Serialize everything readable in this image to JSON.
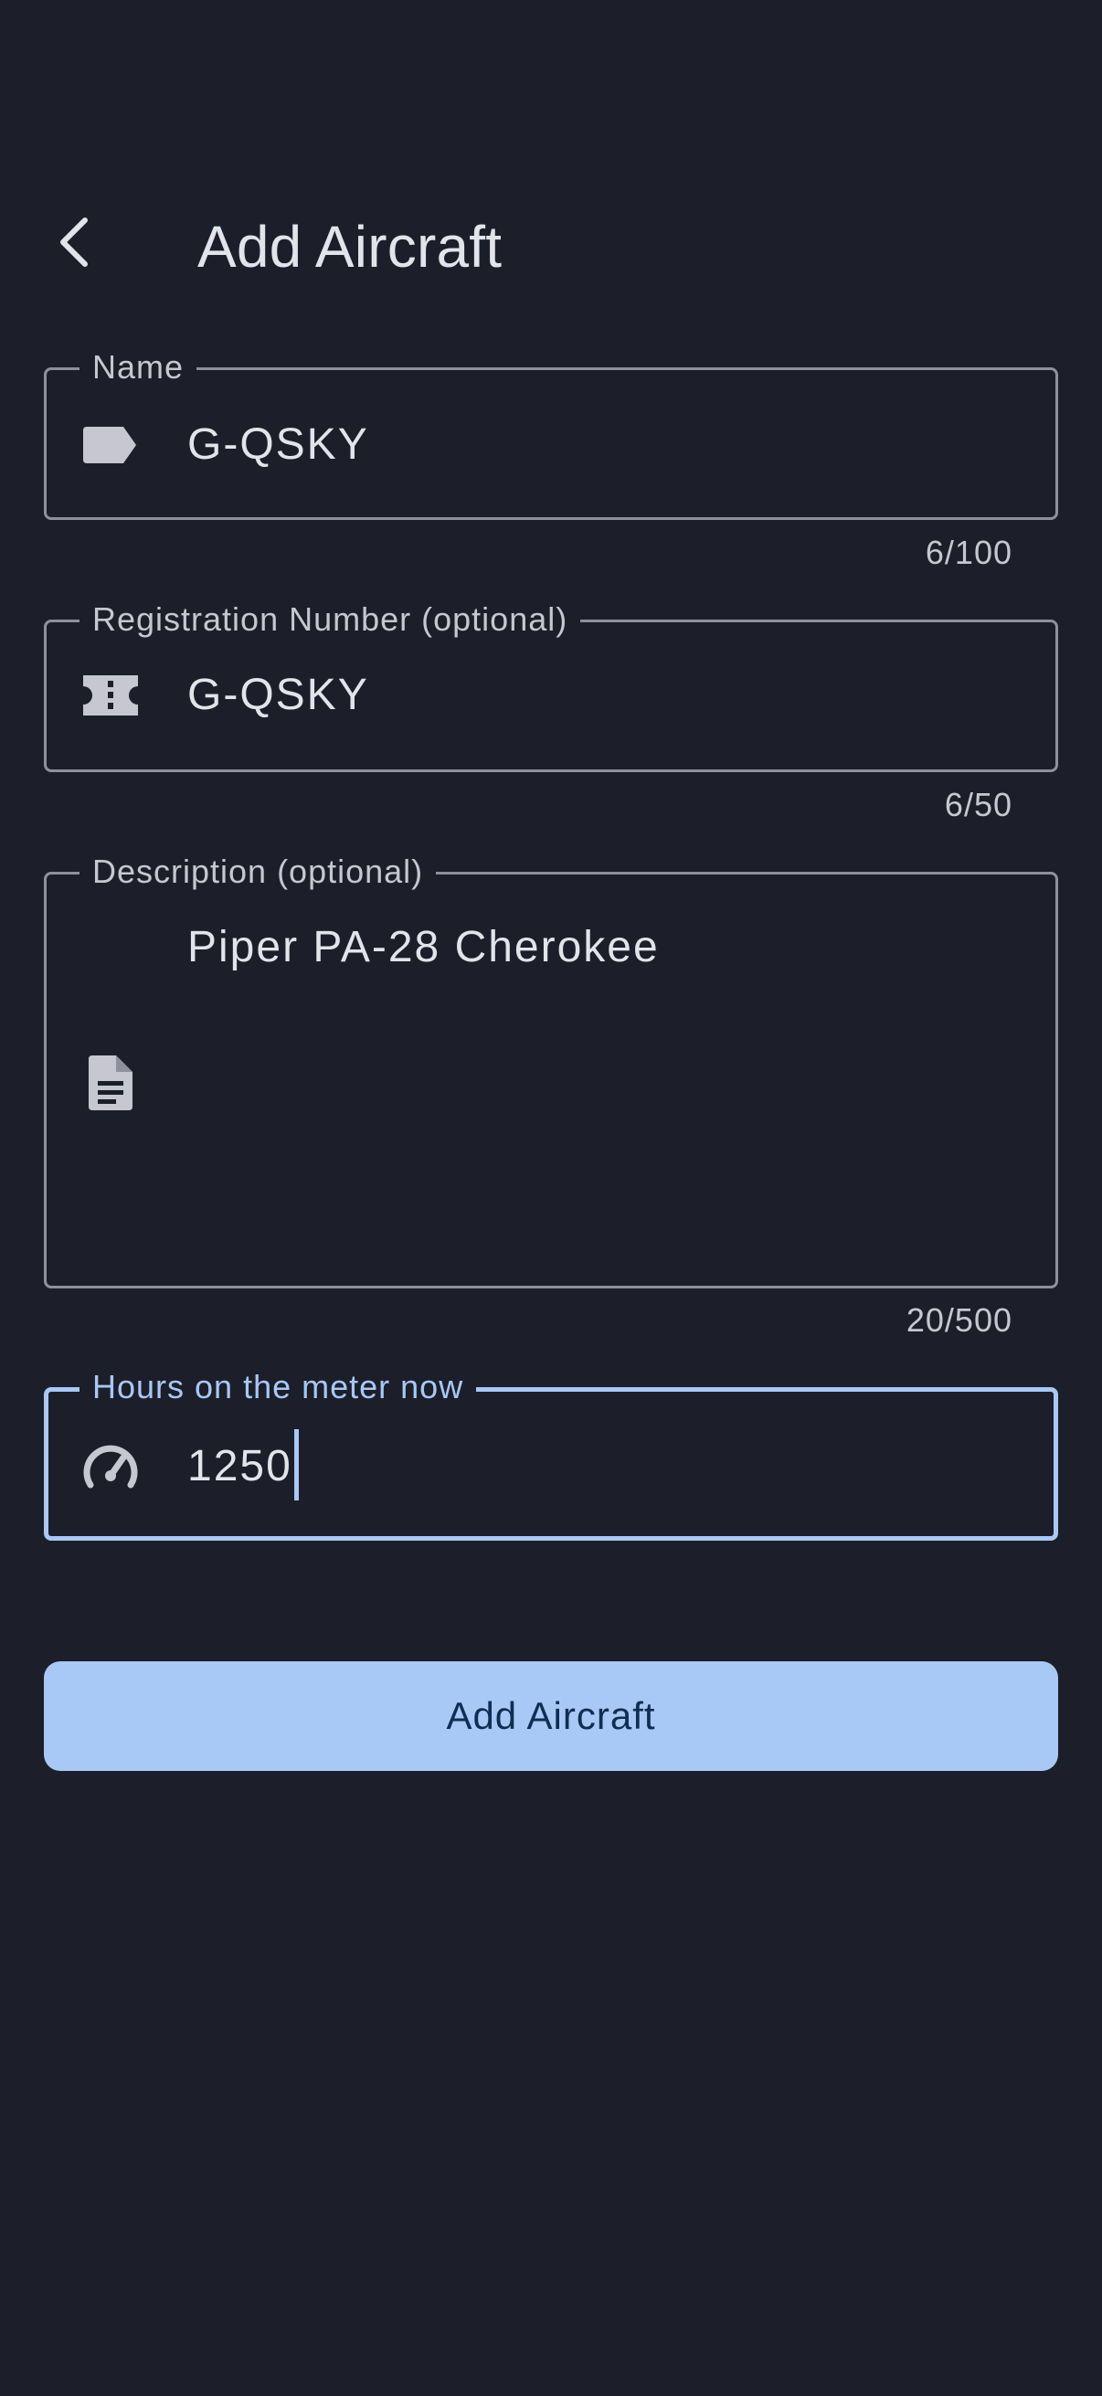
{
  "app_bar": {
    "title": "Add Aircraft",
    "back_icon": "chevron-left-icon"
  },
  "form": {
    "name": {
      "label": "Name",
      "value": "G-QSKY",
      "counter": "6/100",
      "icon": "label-tag-icon"
    },
    "registration": {
      "label": "Registration Number (optional)",
      "value": "G-QSKY",
      "counter": "6/50",
      "icon": "ticket-icon"
    },
    "description": {
      "label": "Description (optional)",
      "value": "Piper PA-28 Cherokee",
      "counter": "20/500",
      "icon": "document-icon"
    },
    "hours": {
      "label": "Hours on the meter now",
      "value": "1250",
      "icon": "speedometer-icon"
    }
  },
  "actions": {
    "submit_label": "Add Aircraft"
  },
  "colors": {
    "background": "#1c1f29",
    "outline": "#8e919c",
    "accent": "#a8c8f5",
    "button_text": "#0f2e52",
    "text": "#e3e3ea"
  }
}
